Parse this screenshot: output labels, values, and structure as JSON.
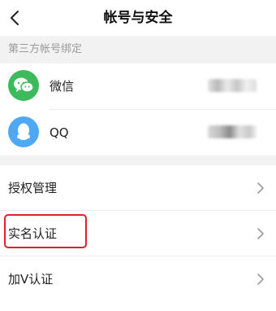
{
  "header": {
    "title": "帐号与安全",
    "back_icon": "chevron-left-icon"
  },
  "third_party": {
    "section_label": "第三方帐号绑定",
    "items": [
      {
        "name": "微信",
        "icon": "wechat-icon",
        "color": "#3dbb5c"
      },
      {
        "name": "QQ",
        "icon": "qq-icon",
        "color": "#4fa8f4"
      }
    ]
  },
  "menu": {
    "items": [
      {
        "label": "授权管理",
        "icon": "chevron-right-icon"
      },
      {
        "label": "实名认证",
        "icon": "chevron-right-icon",
        "highlighted": true
      },
      {
        "label": "加V认证",
        "icon": "chevron-right-icon"
      }
    ]
  },
  "colors": {
    "highlight": "#e0202a",
    "background": "#f2f2f2"
  }
}
